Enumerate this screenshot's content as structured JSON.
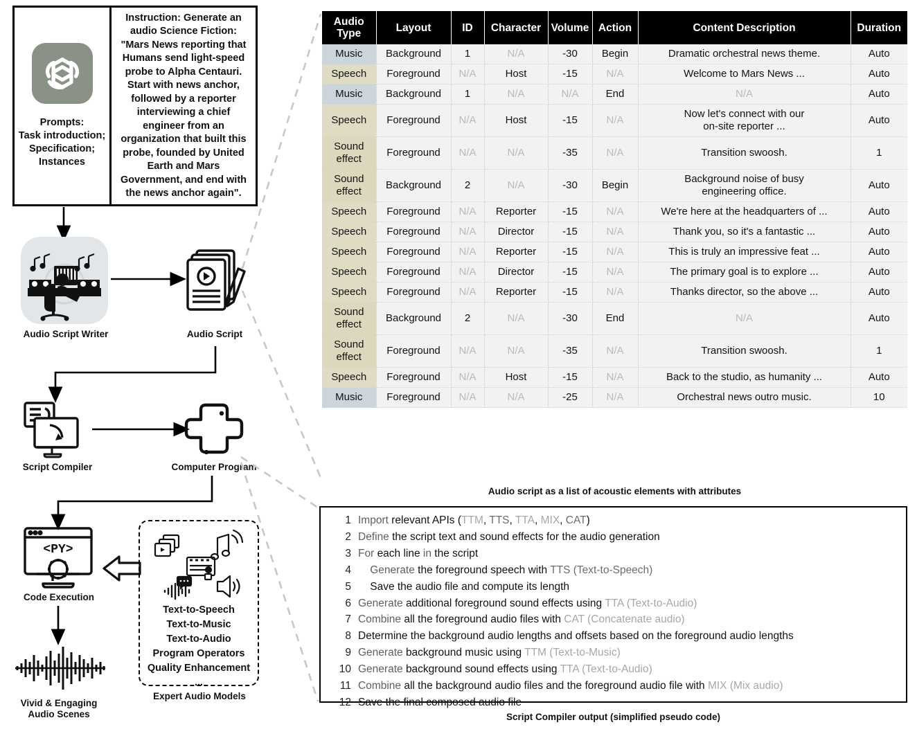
{
  "prompt_box": {
    "logo_name": "openai-logo",
    "left_lines": [
      "Prompts:",
      "Task introduction;",
      "Specification;",
      "Instances"
    ],
    "instruction": "Instruction: Generate an audio Science Fiction: \"Mars News reporting that Humans send light-speed probe to Alpha Centauri. Start with news anchor, followed by a reporter interviewing a chief engineer from an organization that built this probe, founded by United Earth and Mars Government, and end with the news anchor again\"."
  },
  "flow": {
    "audio_script_writer": "Audio Script Writer",
    "audio_script": "Audio Script",
    "script_compiler": "Script Compiler",
    "computer_program": "Computer Program",
    "code_execution": "Code Execution",
    "vivid_scenes_line1": "Vivid & Engaging",
    "vivid_scenes_line2": "Audio Scenes",
    "expert_audio_models": "Expert Audio Models",
    "expert_items": [
      "Text-to-Speech",
      "Text-to-Music",
      "Text-to-Audio",
      "Program Operators",
      "Quality Enhancement",
      "..."
    ]
  },
  "table": {
    "caption": "Audio script as a list of  acoustic elements with attributes",
    "headers": [
      "Audio Type",
      "Layout",
      "ID",
      "Character",
      "Volume",
      "Action",
      "Content Description",
      "Duration"
    ],
    "header_audio_type_l1": "Audio",
    "header_audio_type_l2": "Type",
    "rows": [
      {
        "type": "Music",
        "type_class": "r-music",
        "layout": "Background",
        "id": "1",
        "character": "N/A",
        "volume": "-30",
        "action": "Begin",
        "desc": "Dramatic orchestral news theme.",
        "duration": "Auto"
      },
      {
        "type": "Speech",
        "type_class": "r-speech",
        "layout": "Foreground",
        "id": "N/A",
        "character": "Host",
        "volume": "-15",
        "action": "N/A",
        "desc": "Welcome to Mars News ...",
        "duration": "Auto"
      },
      {
        "type": "Music",
        "type_class": "r-music",
        "layout": "Background",
        "id": "1",
        "character": "N/A",
        "volume": "N/A",
        "action": "End",
        "desc": "N/A",
        "duration": "Auto"
      },
      {
        "type": "Speech",
        "type_class": "r-speech",
        "layout": "Foreground",
        "id": "N/A",
        "character": "Host",
        "volume": "-15",
        "action": "N/A",
        "desc": "Now let's connect with our\non-site reporter ...",
        "duration": "Auto"
      },
      {
        "type": "Sound effect",
        "type_class": "r-sound",
        "layout": "Foreground",
        "id": "N/A",
        "character": "N/A",
        "volume": "-35",
        "action": "N/A",
        "desc": "Transition swoosh.",
        "duration": "1"
      },
      {
        "type": "Sound effect",
        "type_class": "r-sound",
        "layout": "Background",
        "id": "2",
        "character": "N/A",
        "volume": "-30",
        "action": "Begin",
        "desc": "Background noise of busy\nengineering office.",
        "duration": "Auto"
      },
      {
        "type": "Speech",
        "type_class": "r-speech",
        "layout": "Foreground",
        "id": "N/A",
        "character": "Reporter",
        "volume": "-15",
        "action": "N/A",
        "desc": "We're here at the headquarters of ...",
        "duration": "Auto"
      },
      {
        "type": "Speech",
        "type_class": "r-speech",
        "layout": "Foreground",
        "id": "N/A",
        "character": "Director",
        "volume": "-15",
        "action": "N/A",
        "desc": "Thank you, so it's a fantastic ...",
        "duration": "Auto"
      },
      {
        "type": "Speech",
        "type_class": "r-speech",
        "layout": "Foreground",
        "id": "N/A",
        "character": "Reporter",
        "volume": "-15",
        "action": "N/A",
        "desc": "This is truly an impressive feat ...",
        "duration": "Auto"
      },
      {
        "type": "Speech",
        "type_class": "r-speech",
        "layout": "Foreground",
        "id": "N/A",
        "character": "Director",
        "volume": "-15",
        "action": "N/A",
        "desc": "The primary goal is to explore ...",
        "duration": "Auto"
      },
      {
        "type": "Speech",
        "type_class": "r-speech",
        "layout": "Foreground",
        "id": "N/A",
        "character": "Reporter",
        "volume": "-15",
        "action": "N/A",
        "desc": "Thanks director, so the above ...",
        "duration": "Auto"
      },
      {
        "type": "Sound effect",
        "type_class": "r-sound",
        "layout": "Background",
        "id": "2",
        "character": "N/A",
        "volume": "-30",
        "action": "End",
        "desc": "N/A",
        "duration": "Auto"
      },
      {
        "type": "Sound effect",
        "type_class": "r-sound",
        "layout": "Foreground",
        "id": "N/A",
        "character": "N/A",
        "volume": "-35",
        "action": "N/A",
        "desc": "Transition swoosh.",
        "duration": "1"
      },
      {
        "type": "Speech",
        "type_class": "r-speech",
        "layout": "Foreground",
        "id": "N/A",
        "character": "Host",
        "volume": "-15",
        "action": "N/A",
        "desc": "Back to the studio, as humanity ...",
        "duration": "Auto"
      },
      {
        "type": "Music",
        "type_class": "r-music",
        "layout": "Foreground",
        "id": "N/A",
        "character": "N/A",
        "volume": "-25",
        "action": "N/A",
        "desc": "Orchestral news outro music.",
        "duration": "10"
      }
    ]
  },
  "code": {
    "caption": "Script Compiler output (simplified pseudo code)",
    "lines": [
      {
        "n": "1",
        "parts": [
          {
            "t": "Import ",
            "c": "kw"
          },
          {
            "t": "relevant APIs (",
            "c": ""
          },
          {
            "t": "TTM",
            "c": "api"
          },
          {
            "t": ", ",
            "c": ""
          },
          {
            "t": "TTS",
            "c": "api2"
          },
          {
            "t": ", ",
            "c": ""
          },
          {
            "t": "TTA",
            "c": "api"
          },
          {
            "t": ", ",
            "c": ""
          },
          {
            "t": "MIX",
            "c": "api"
          },
          {
            "t": ", ",
            "c": ""
          },
          {
            "t": "CAT",
            "c": "api2"
          },
          {
            "t": ")",
            "c": ""
          }
        ]
      },
      {
        "n": "2",
        "parts": [
          {
            "t": "Define ",
            "c": "kw"
          },
          {
            "t": "the script text and sound effects for the audio generation",
            "c": ""
          }
        ]
      },
      {
        "n": "3",
        "parts": [
          {
            "t": "For ",
            "c": "kw"
          },
          {
            "t": "each line ",
            "c": ""
          },
          {
            "t": "in ",
            "c": "kw"
          },
          {
            "t": "the script",
            "c": ""
          }
        ]
      },
      {
        "n": "4",
        "parts": [
          {
            "t": "    ",
            "c": ""
          },
          {
            "t": "Generate ",
            "c": "kw"
          },
          {
            "t": "the foreground speech with ",
            "c": ""
          },
          {
            "t": "TTS (Text-to-Speech)",
            "c": "api2"
          }
        ]
      },
      {
        "n": "5",
        "parts": [
          {
            "t": "    ",
            "c": ""
          },
          {
            "t": "Save the audio file and compute its length",
            "c": ""
          }
        ]
      },
      {
        "n": "6",
        "parts": [
          {
            "t": "Generate ",
            "c": "kw"
          },
          {
            "t": "additional foreground sound effects using ",
            "c": ""
          },
          {
            "t": "TTA (Text-to-Audio)",
            "c": "api"
          }
        ]
      },
      {
        "n": "7",
        "parts": [
          {
            "t": "Combine ",
            "c": "kw"
          },
          {
            "t": "all the foreground audio files with ",
            "c": ""
          },
          {
            "t": "CAT (Concatenate audio)",
            "c": "api"
          }
        ]
      },
      {
        "n": "8",
        "parts": [
          {
            "t": "Determine the background audio lengths and offsets based on the foreground audio lengths",
            "c": ""
          }
        ]
      },
      {
        "n": "9",
        "parts": [
          {
            "t": "Generate ",
            "c": "kw"
          },
          {
            "t": "background music using ",
            "c": ""
          },
          {
            "t": "TTM (Text-to-Music)",
            "c": "api"
          }
        ]
      },
      {
        "n": "10",
        "parts": [
          {
            "t": "Generate ",
            "c": "kw"
          },
          {
            "t": "background sound effects using ",
            "c": ""
          },
          {
            "t": "TTA (Text-to-Audio)",
            "c": "api"
          }
        ]
      },
      {
        "n": "11",
        "parts": [
          {
            "t": "Combine ",
            "c": "kw"
          },
          {
            "t": "all the background audio files and the foreground audio file with ",
            "c": ""
          },
          {
            "t": "MIX (Mix audio)",
            "c": "api"
          }
        ]
      },
      {
        "n": "12",
        "parts": [
          {
            "t": "Save the final composed audio file",
            "c": ""
          }
        ]
      }
    ]
  },
  "colors": {
    "music_row": "#ccd5dc",
    "speech_row": "#e0dcc4",
    "sound_row": "#ddd8bd",
    "cell_bg": "#f2f2f2",
    "header_bg": "#000000",
    "logo_bg": "#8a9187",
    "dashed_connector": "#c8c8c8"
  }
}
